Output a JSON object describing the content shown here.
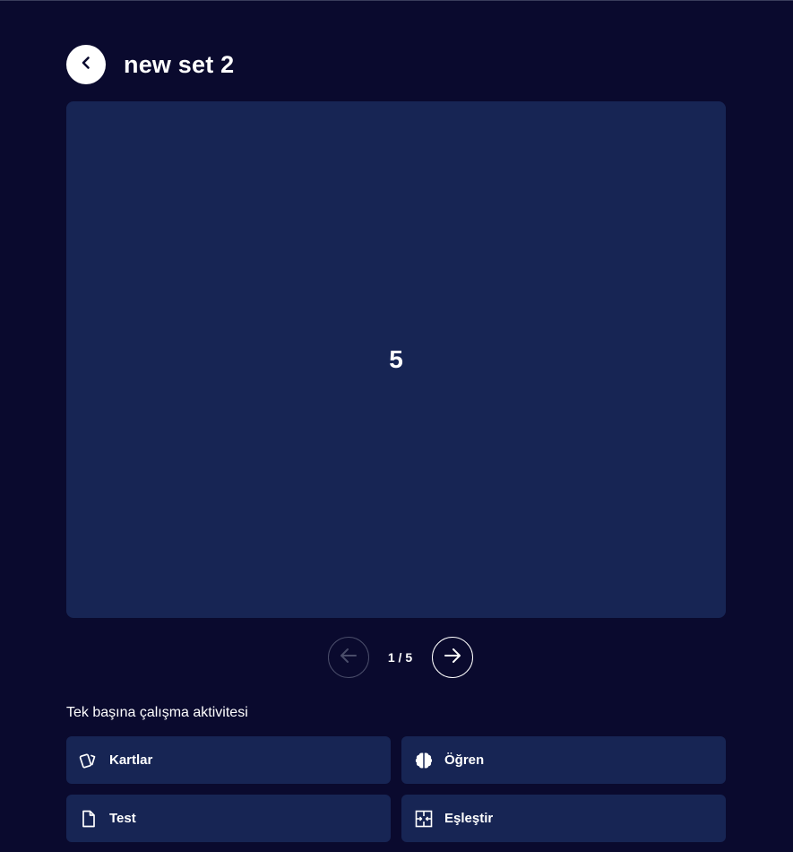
{
  "header": {
    "title": "new set 2"
  },
  "card": {
    "text": "5"
  },
  "navigation": {
    "counter": "1 / 5",
    "prev_enabled": false,
    "next_enabled": true
  },
  "activities": {
    "heading": "Tek başına çalışma aktivitesi",
    "items": [
      {
        "label": "Kartlar",
        "icon": "cards-icon"
      },
      {
        "label": "Öğren",
        "icon": "brain-icon"
      },
      {
        "label": "Test",
        "icon": "document-icon"
      },
      {
        "label": "Eşleştir",
        "icon": "match-icon"
      }
    ]
  },
  "colors": {
    "background": "#0a0a2e",
    "card": "#172554",
    "text": "#ffffff"
  }
}
